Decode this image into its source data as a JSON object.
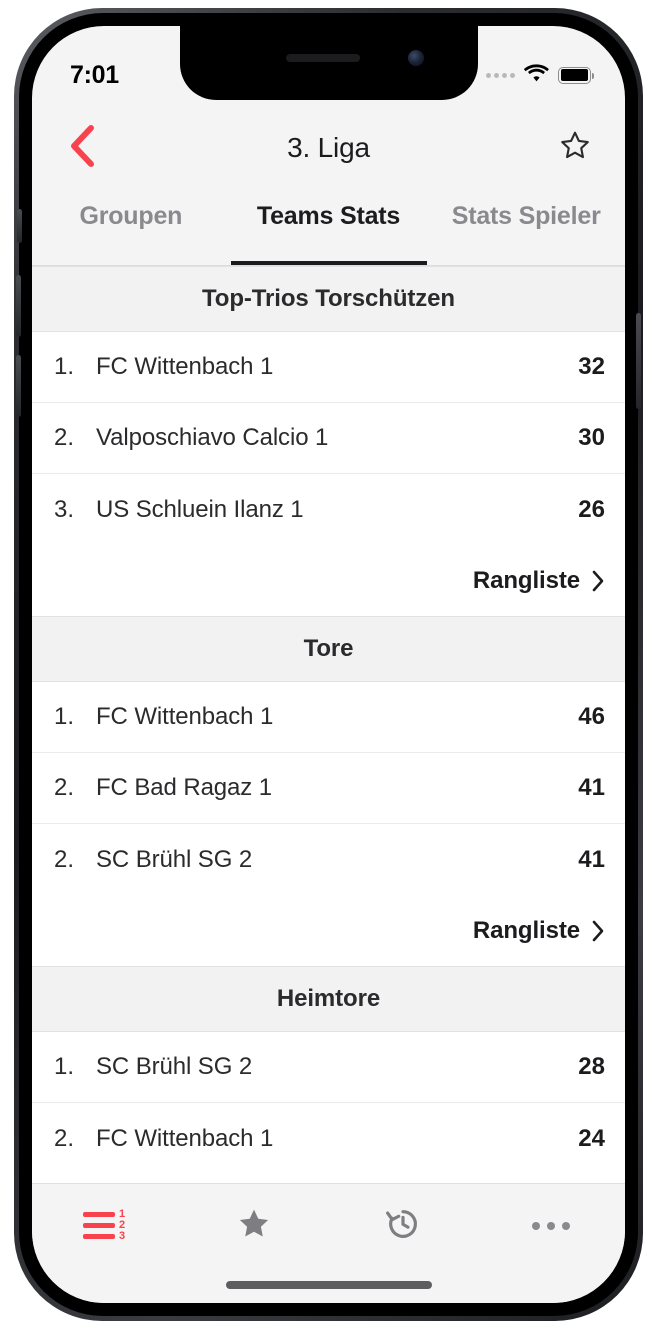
{
  "status_bar": {
    "time": "7:01",
    "signal_icon": "cellular-dots-icon",
    "wifi_icon": "wifi-icon",
    "battery_icon": "battery-full-icon"
  },
  "nav": {
    "back_icon": "chevron-left-icon",
    "title": "3. Liga",
    "favorite_icon": "star-outline-icon"
  },
  "tabs": [
    {
      "label": "Groupen",
      "active": false
    },
    {
      "label": "Teams Stats",
      "active": true
    },
    {
      "label": "Stats Spieler",
      "active": false
    }
  ],
  "sections": [
    {
      "title": "Top-Trios Torschützen",
      "rows": [
        {
          "rank": "1.",
          "name": "FC Wittenbach 1",
          "value": "32"
        },
        {
          "rank": "2.",
          "name": "Valposchiavo Calcio 1",
          "value": "30"
        },
        {
          "rank": "3.",
          "name": "US Schluein Ilanz 1",
          "value": "26"
        }
      ],
      "link_label": "Rangliste",
      "link_icon": "chevron-right-icon"
    },
    {
      "title": "Tore",
      "rows": [
        {
          "rank": "1.",
          "name": "FC Wittenbach 1",
          "value": "46"
        },
        {
          "rank": "2.",
          "name": "FC Bad Ragaz 1",
          "value": "41"
        },
        {
          "rank": "2.",
          "name": "SC Brühl SG 2",
          "value": "41"
        }
      ],
      "link_label": "Rangliste",
      "link_icon": "chevron-right-icon"
    },
    {
      "title": "Heimtore",
      "rows": [
        {
          "rank": "1.",
          "name": "SC Brühl SG 2",
          "value": "28"
        },
        {
          "rank": "2.",
          "name": "FC Wittenbach 1",
          "value": "24"
        }
      ],
      "link_label": null,
      "link_icon": null
    }
  ],
  "bottom_bar": [
    {
      "icon": "ranking-list-icon",
      "active": true,
      "numbers": [
        "1",
        "2",
        "3"
      ]
    },
    {
      "icon": "star-filled-icon",
      "active": false
    },
    {
      "icon": "history-clock-icon",
      "active": false
    },
    {
      "icon": "ellipsis-icon",
      "active": false
    }
  ],
  "colors": {
    "accent": "#f8434e",
    "active_text": "#1c1c1e",
    "inactive_text": "#8a8a8e",
    "section_bg": "#f2f2f2",
    "chrome_bg": "#f4f4f4"
  }
}
